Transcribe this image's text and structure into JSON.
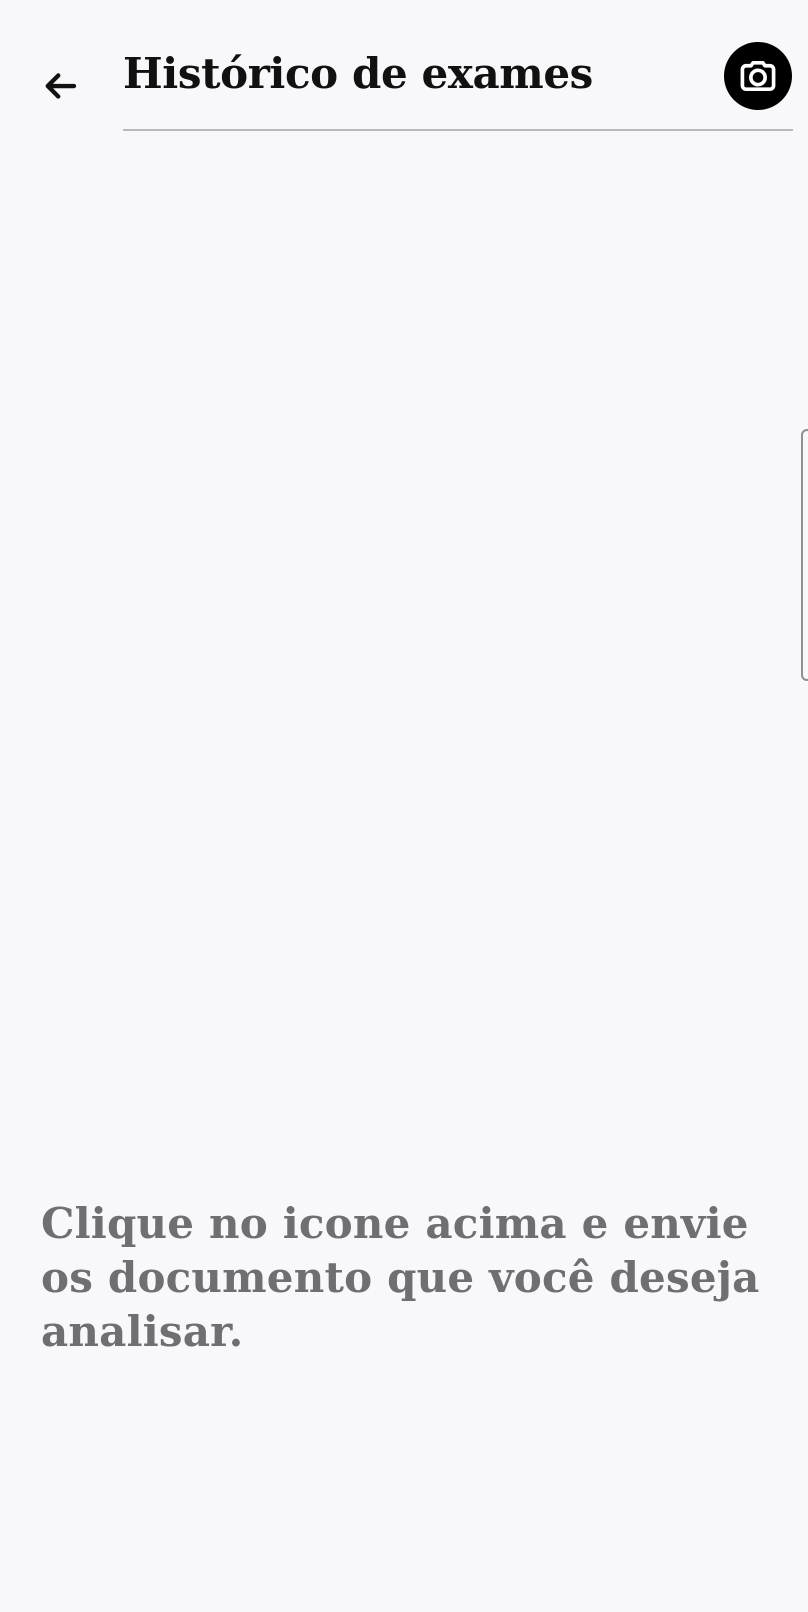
{
  "header": {
    "title": "Histórico de exames",
    "back_icon": "arrow-left-icon",
    "camera_icon": "camera-icon"
  },
  "main": {
    "empty_message": "Clique no icone acima e envie os documento que você deseja analisar."
  },
  "colors": {
    "background": "#f8f8fb",
    "title_text": "#111111",
    "camera_button_background": "#000000",
    "divider": "#b9b9bd",
    "message_text": "#6f6f73"
  }
}
